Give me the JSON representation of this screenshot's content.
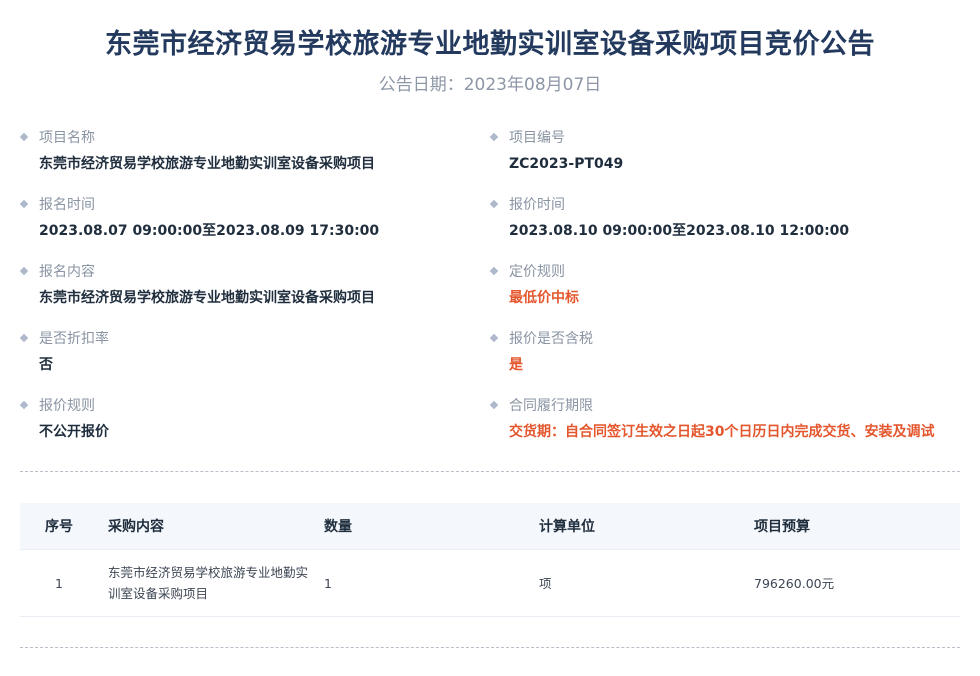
{
  "header": {
    "title": "东莞市经济贸易学校旅游专业地勤实训室设备采购项目竞价公告",
    "date_label": "公告日期：",
    "date_value": "2023年08月07日"
  },
  "info": {
    "items": [
      {
        "label": "项目名称",
        "value": "东莞市经济贸易学校旅游专业地勤实训室设备采购项目",
        "highlight": false
      },
      {
        "label": "项目编号",
        "value": "ZC2023-PT049",
        "highlight": false
      },
      {
        "label": "报名时间",
        "value": "2023.08.07 09:00:00至2023.08.09 17:30:00",
        "highlight": false
      },
      {
        "label": "报价时间",
        "value": "2023.08.10 09:00:00至2023.08.10 12:00:00",
        "highlight": false
      },
      {
        "label": "报名内容",
        "value": "东莞市经济贸易学校旅游专业地勤实训室设备采购项目",
        "highlight": false
      },
      {
        "label": "定价规则",
        "value": "最低价中标",
        "highlight": true
      },
      {
        "label": "是否折扣率",
        "value": "否",
        "highlight": false
      },
      {
        "label": "报价是否含税",
        "value": "是",
        "highlight": true
      },
      {
        "label": "报价规则",
        "value": "不公开报价",
        "highlight": false
      },
      {
        "label": "合同履行期限",
        "value": "交货期：自合同签订生效之日起30个日历日内完成交货、安装及调试",
        "highlight": true
      }
    ]
  },
  "table": {
    "headers": {
      "idx": "序号",
      "content": "采购内容",
      "qty": "数量",
      "unit": "计算单位",
      "budget": "项目预算"
    },
    "rows": [
      {
        "idx": "1",
        "content": "东莞市经济贸易学校旅游专业地勤实训室设备采购项目",
        "qty": "1",
        "unit": "项",
        "budget": "796260.00元"
      }
    ]
  },
  "colors": {
    "title": "#233a5e",
    "highlight": "#e4572e",
    "label": "#8a94a3",
    "table_header_bg": "#f4f7fb"
  }
}
